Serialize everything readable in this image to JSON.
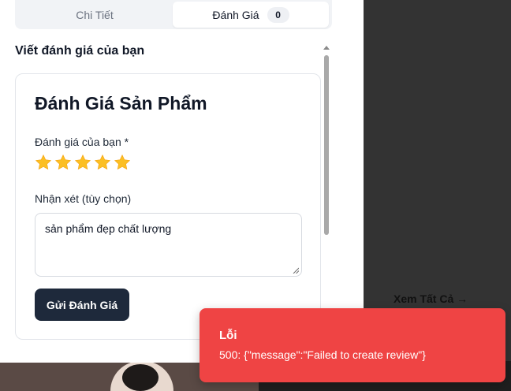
{
  "tabs": [
    {
      "label": "Chi Tiết",
      "active": false
    },
    {
      "label": "Đánh Giá",
      "active": true,
      "count": "0"
    }
  ],
  "section_title": "Viết đánh giá của bạn",
  "review_form": {
    "title": "Đánh Giá Sản Phẩm",
    "rating_label": "Đánh giá của bạn *",
    "rating": 5,
    "max_rating": 5,
    "comment_label": "Nhận xét (tùy chọn)",
    "comment_value": "sản phẩm đẹp chất lượng",
    "submit_label": "Gửi Đánh Giá"
  },
  "background": {
    "see_all_label": "Xem Tất Cả →"
  },
  "toast": {
    "title": "Lỗi",
    "message": "500: {\"message\":\"Failed to create review\"}"
  },
  "colors": {
    "star": "#fbbf24",
    "submit_bg": "#1e293b",
    "toast_bg": "#ef4444"
  }
}
